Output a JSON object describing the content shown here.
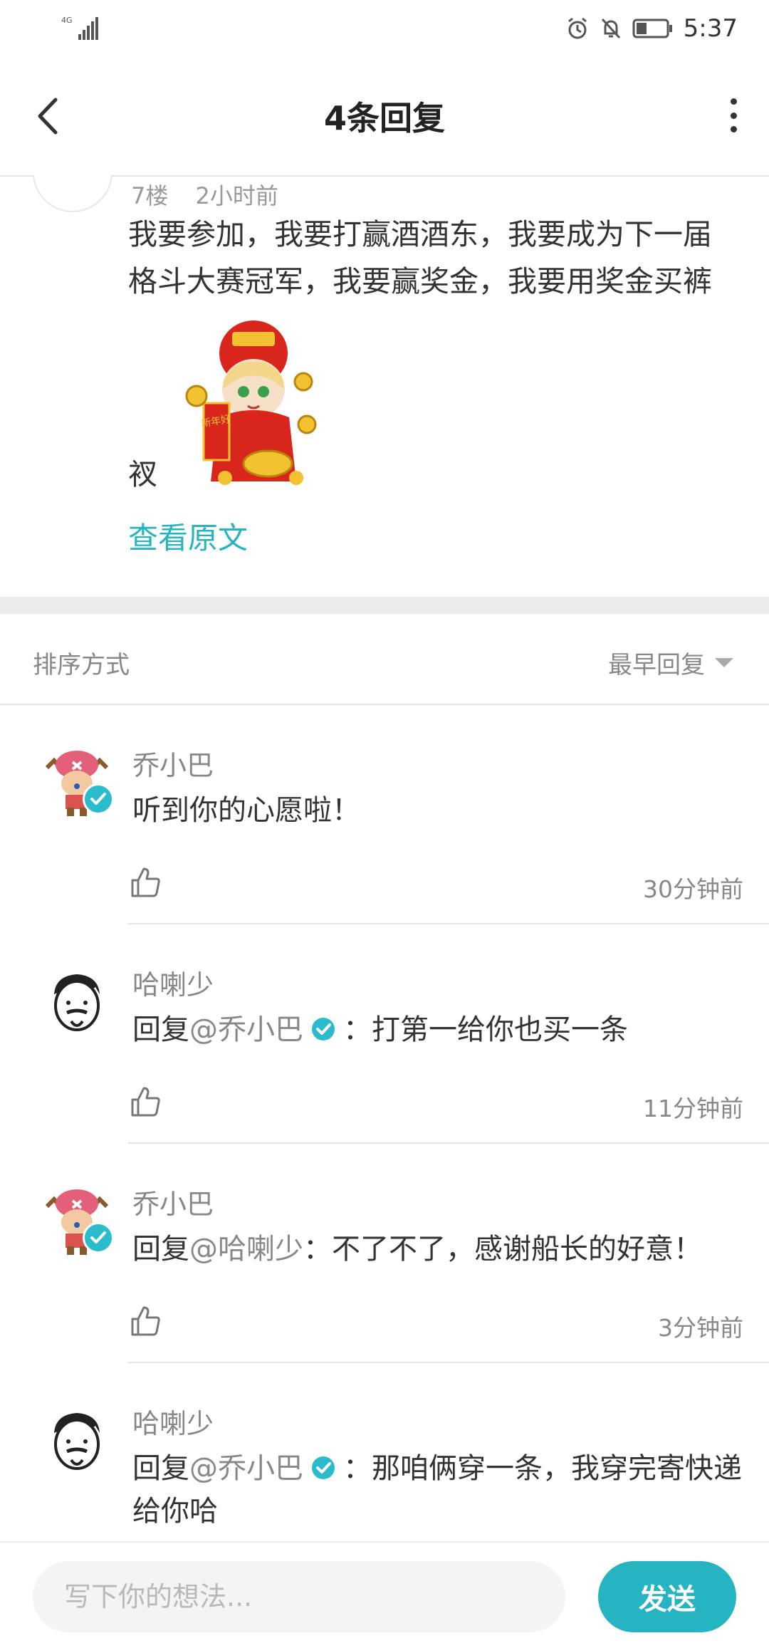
{
  "status_bar": {
    "network": "4G",
    "time": "5:37",
    "icons": [
      "signal-icon",
      "alarm-icon",
      "bell-muted-icon",
      "battery-icon"
    ]
  },
  "header": {
    "title": "4条回复",
    "icons": [
      "back-arrow-icon",
      "more-vertical-icon"
    ]
  },
  "original_post": {
    "floor": "7楼",
    "time": "2小时前",
    "text": "我要参加，我要打赢酒酒东，我要成为下一届格斗大赛冠军，我要赢奖金，我要用奖金买裤",
    "text_tail": "衩",
    "sticker_caption": "新年好",
    "view_original": "查看原文"
  },
  "sort": {
    "label": "排序方式",
    "value": "最早回复"
  },
  "replies": [
    {
      "name": "乔小巴",
      "verified": true,
      "mention_prefix": "",
      "mention": "",
      "text": "听到你的心愿啦！",
      "time": "30分钟前",
      "avatar": "chopper-avatar-icon"
    },
    {
      "name": "哈喇少",
      "verified": false,
      "mention_prefix": "回复",
      "mention": "@乔小巴",
      "text": "：打第一给你也买一条",
      "time": "11分钟前",
      "avatar": "bearded-face-avatar-icon"
    },
    {
      "name": "乔小巴",
      "verified": true,
      "mention_prefix": "回复",
      "mention": "@哈喇少",
      "text": "：不了不了，感谢船长的好意！",
      "time": "3分钟前",
      "avatar": "chopper-avatar-icon"
    },
    {
      "name": "哈喇少",
      "verified": false,
      "mention_prefix": "回复",
      "mention": "@乔小巴",
      "text": "：那咱俩穿一条，我穿完寄快递给你哈",
      "time": "",
      "avatar": "bearded-face-avatar-icon"
    }
  ],
  "input": {
    "placeholder": "写下你的想法...",
    "send_label": "发送"
  },
  "colors": {
    "accent": "#26b3c2",
    "text": "#333333",
    "muted": "#888888",
    "divider": "#e6e6e6"
  }
}
